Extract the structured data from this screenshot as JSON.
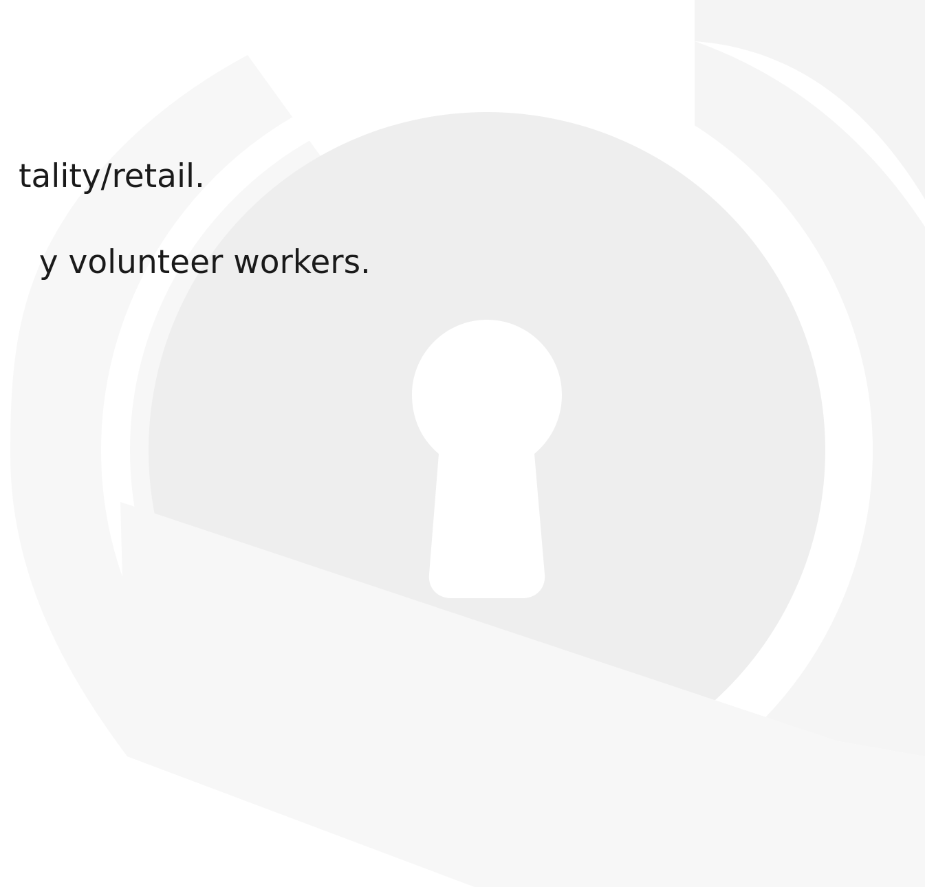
{
  "slide": {
    "lines": [
      "tality/retail.",
      "y volunteer workers."
    ]
  },
  "watermark": {
    "icon": "keyhole-lock-icon",
    "colors": {
      "background": "#ffffff",
      "ring_light": "#f7f7f7",
      "ring_mid": "#f4f4f4",
      "disc": "#eeeeee",
      "keyhole": "#ffffff",
      "text": "#1a1a1a"
    }
  }
}
